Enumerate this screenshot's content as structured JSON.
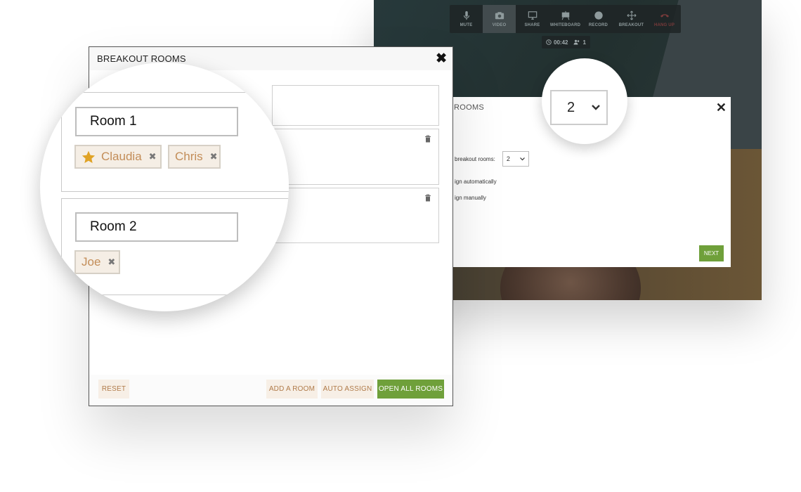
{
  "video_window": {
    "toolbar": [
      {
        "label": "MUTE",
        "icon": "microphone-icon"
      },
      {
        "label": "VIDEO",
        "icon": "camera-icon",
        "active": true
      },
      {
        "label": "SHARE",
        "icon": "monitor-icon"
      },
      {
        "label": "WHITEBOARD",
        "icon": "whiteboard-icon"
      },
      {
        "label": "RECORD",
        "icon": "record-icon"
      },
      {
        "label": "BREAKOUT",
        "icon": "move-arrows-icon"
      },
      {
        "label": "HANG UP",
        "icon": "phone-hangup-icon"
      }
    ],
    "status": {
      "timer": "00:42",
      "participants": "1"
    },
    "setup_dialog": {
      "title": "ROOMS",
      "rooms_label": "breakout rooms:",
      "rooms_value": "2",
      "option_auto": "ign automatically",
      "option_manual": "ign manually",
      "next_label": "NEXT"
    },
    "zoom_select_value": "2"
  },
  "breakout_dialog": {
    "title": "BREAKOUT ROOMS",
    "rooms": [
      {
        "name": "Room 1",
        "participants": [
          {
            "name": "Claudia",
            "host": true
          },
          {
            "name": "Chris",
            "host": false
          }
        ]
      },
      {
        "name": "Room 2",
        "participants": [
          {
            "name": "Joe",
            "host": false
          }
        ]
      }
    ],
    "footer": {
      "reset": "RESET",
      "add_room": "ADD A ROOM",
      "auto_assign": "AUTO ASSIGN",
      "open_all": "OPEN ALL ROOMS"
    }
  },
  "colors": {
    "accent_green": "#6fa03a",
    "chip_text": "#c38d58",
    "star": "#e0a326",
    "light_button_bg": "#f7efe6"
  }
}
